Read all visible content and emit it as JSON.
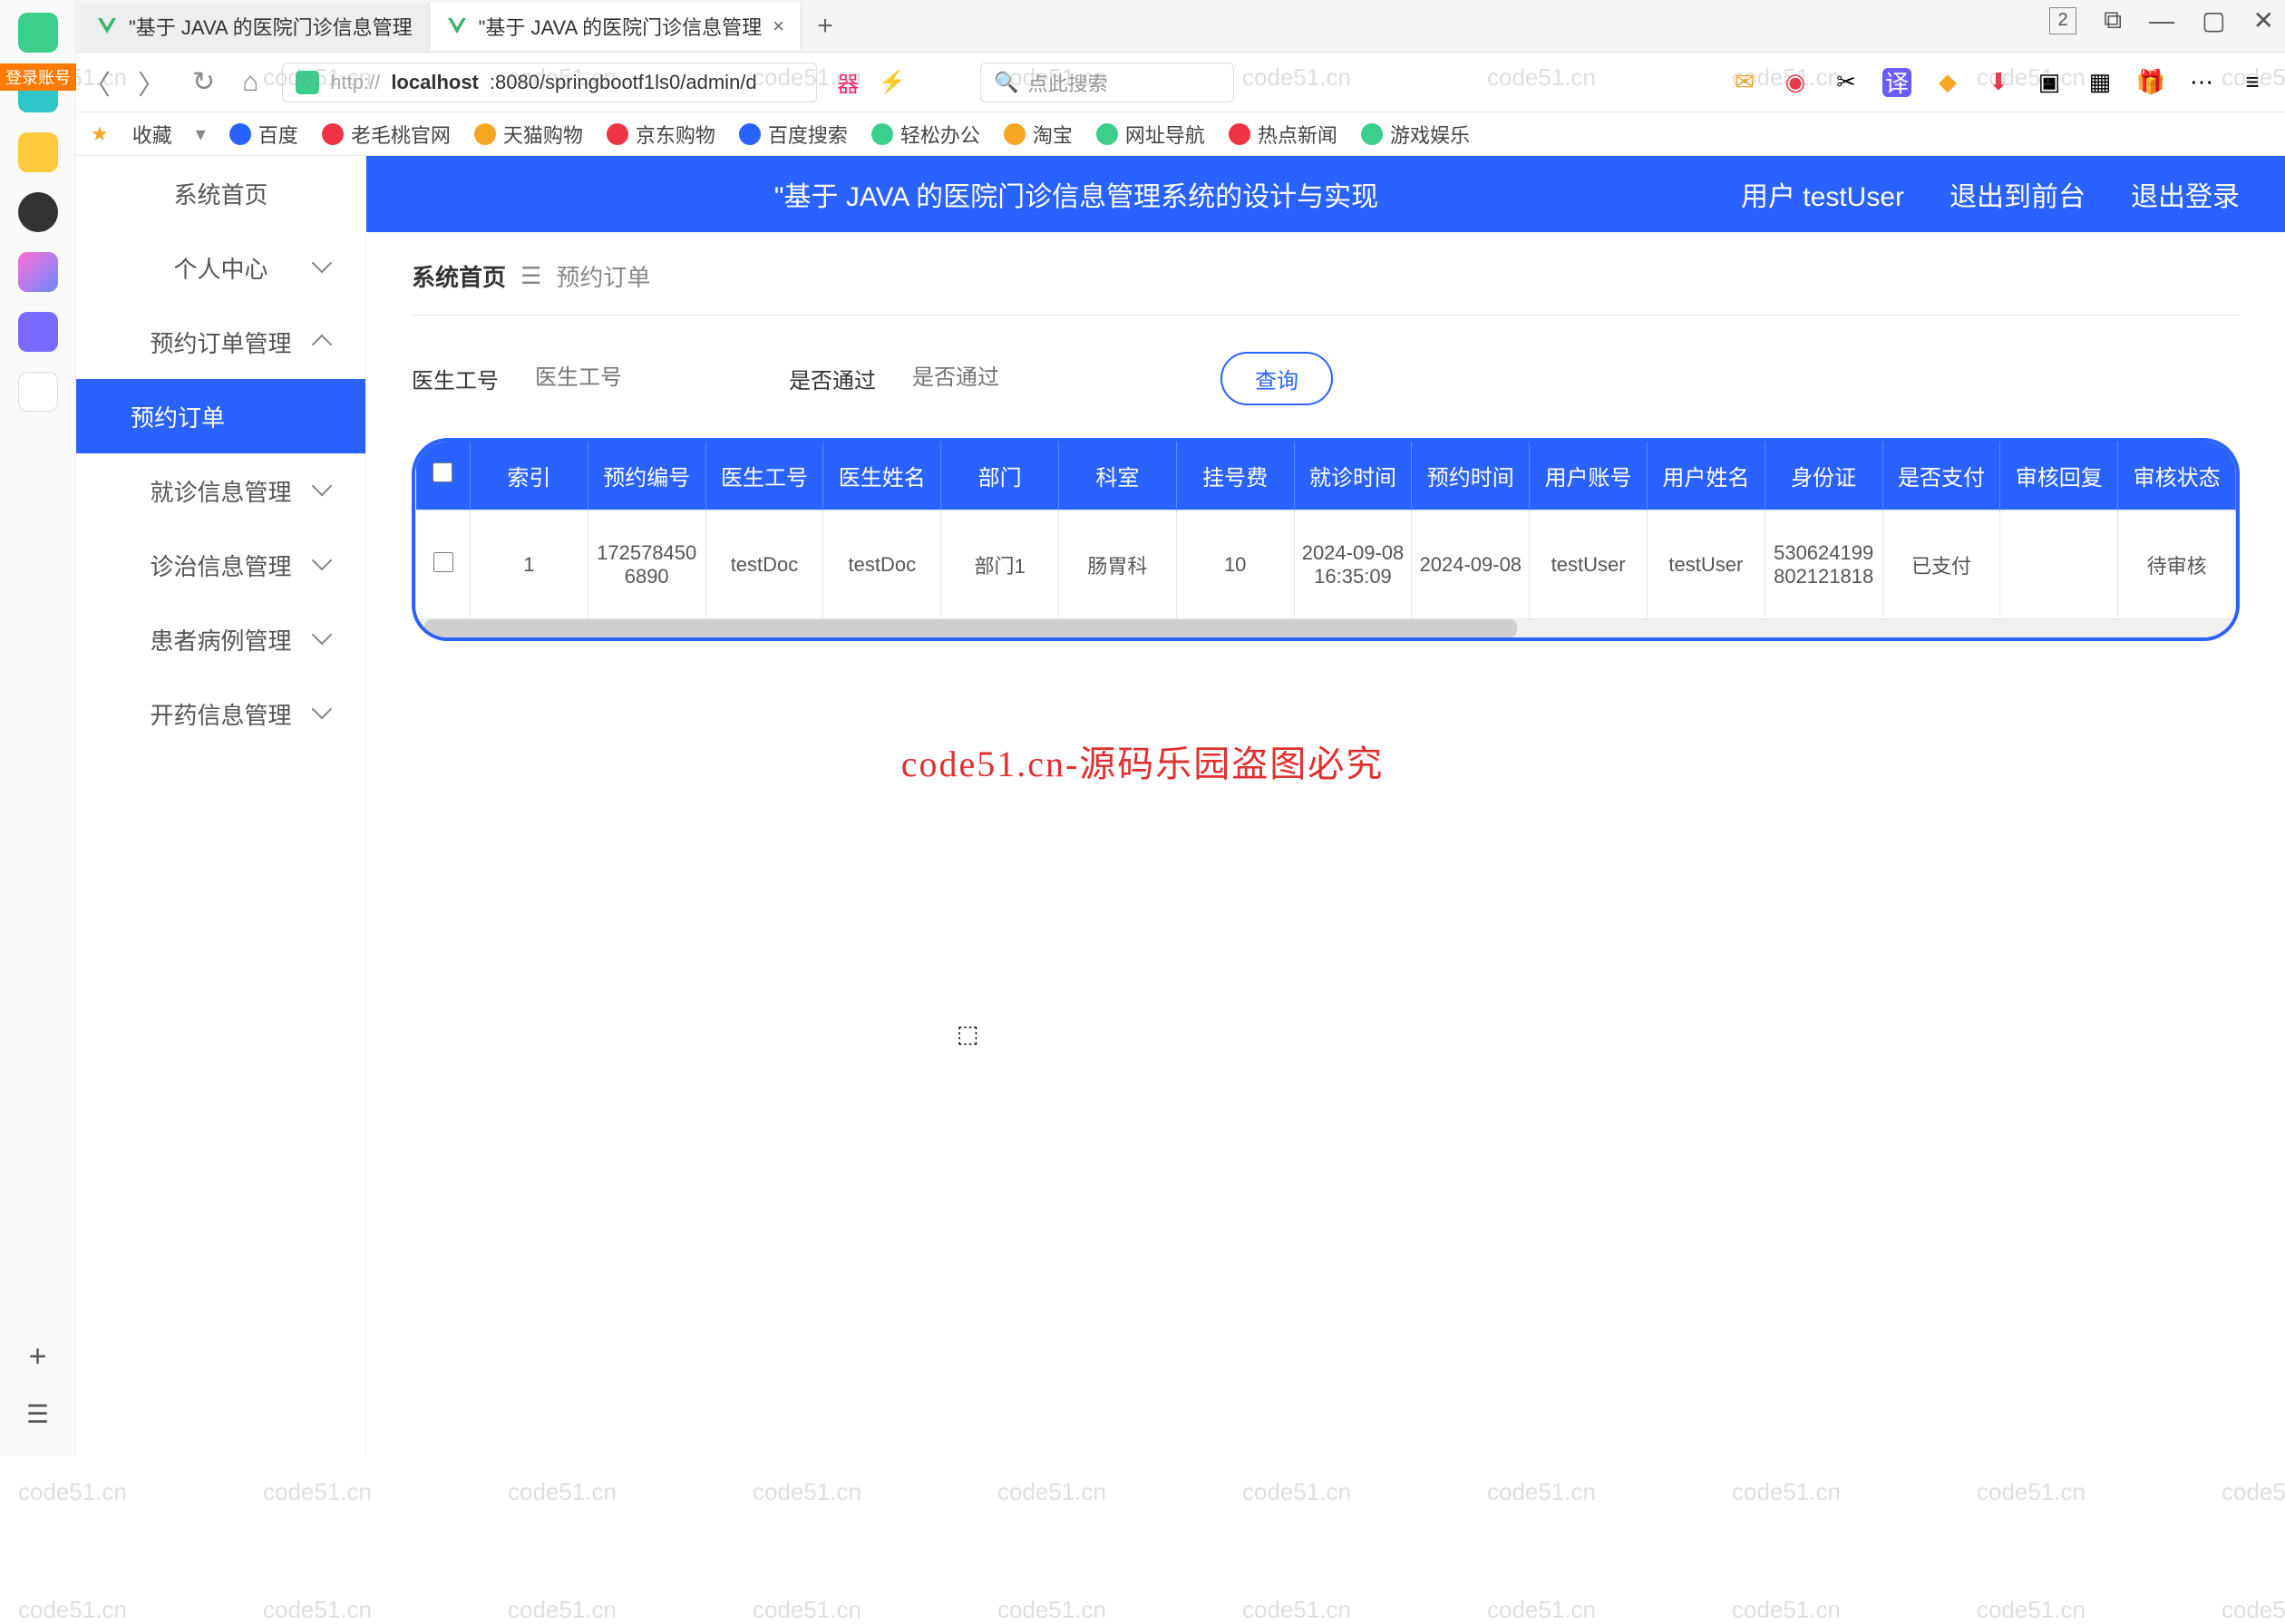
{
  "browser": {
    "tabs": [
      {
        "title": "\"基于 JAVA 的医院门诊信息管理",
        "active": false
      },
      {
        "title": "\"基于 JAVA 的医院门诊信息管理",
        "active": true
      }
    ],
    "url_prefix": "http://",
    "url_host": "localhost",
    "url_rest": ":8080/springbootf1ls0/admin/d",
    "search_placeholder": "点此搜索",
    "win_num": "2"
  },
  "login_tag": "登录账号",
  "bookmarks": {
    "fav": "收藏",
    "items": [
      "百度",
      "老毛桃官网",
      "天猫购物",
      "京东购物",
      "百度搜索",
      "轻松办公",
      "淘宝",
      "网址导航",
      "热点新闻",
      "游戏娱乐"
    ]
  },
  "sidebar": {
    "items": [
      {
        "label": "系统首页",
        "sub": false
      },
      {
        "label": "个人中心",
        "sub": true
      },
      {
        "label": "预约订单管理",
        "sub": true,
        "expanded": true
      },
      {
        "label": "预约订单",
        "selected": true
      },
      {
        "label": "就诊信息管理",
        "sub": true
      },
      {
        "label": "诊治信息管理",
        "sub": true
      },
      {
        "label": "患者病例管理",
        "sub": true
      },
      {
        "label": "开药信息管理",
        "sub": true
      }
    ]
  },
  "topbar": {
    "title": "\"基于 JAVA 的医院门诊信息管理系统的设计与实现",
    "user_prefix": "用户",
    "user": "testUser",
    "link_front": "退出到前台",
    "link_logout": "退出登录"
  },
  "breadcrumb": {
    "home": "系统首页",
    "current": "预约订单"
  },
  "filters": {
    "f1_label": "医生工号",
    "f1_placeholder": "医生工号",
    "f2_label": "是否通过",
    "f2_placeholder": "是否通过",
    "query": "查询"
  },
  "table": {
    "headers": [
      "",
      "索引",
      "预约编号",
      "医生工号",
      "医生姓名",
      "部门",
      "科室",
      "挂号费",
      "就诊时间",
      "预约时间",
      "用户账号",
      "用户姓名",
      "身份证",
      "是否支付",
      "审核回复",
      "审核状态"
    ],
    "row": {
      "index": "1",
      "appt_no": "1725784506890",
      "doc_id": "testDoc",
      "doc_name": "testDoc",
      "dept": "部门1",
      "room": "肠胃科",
      "fee": "10",
      "visit_time": "2024-09-08 16:35:09",
      "appt_time": "2024-09-08",
      "user_acct": "testUser",
      "user_name": "testUser",
      "id_card": "530624199802121818",
      "paid": "已支付",
      "review_reply": "",
      "review_status": "待审核"
    }
  },
  "watermark_text": "code51.cn",
  "watermark_center": "code51.cn-源码乐园盗图必究"
}
